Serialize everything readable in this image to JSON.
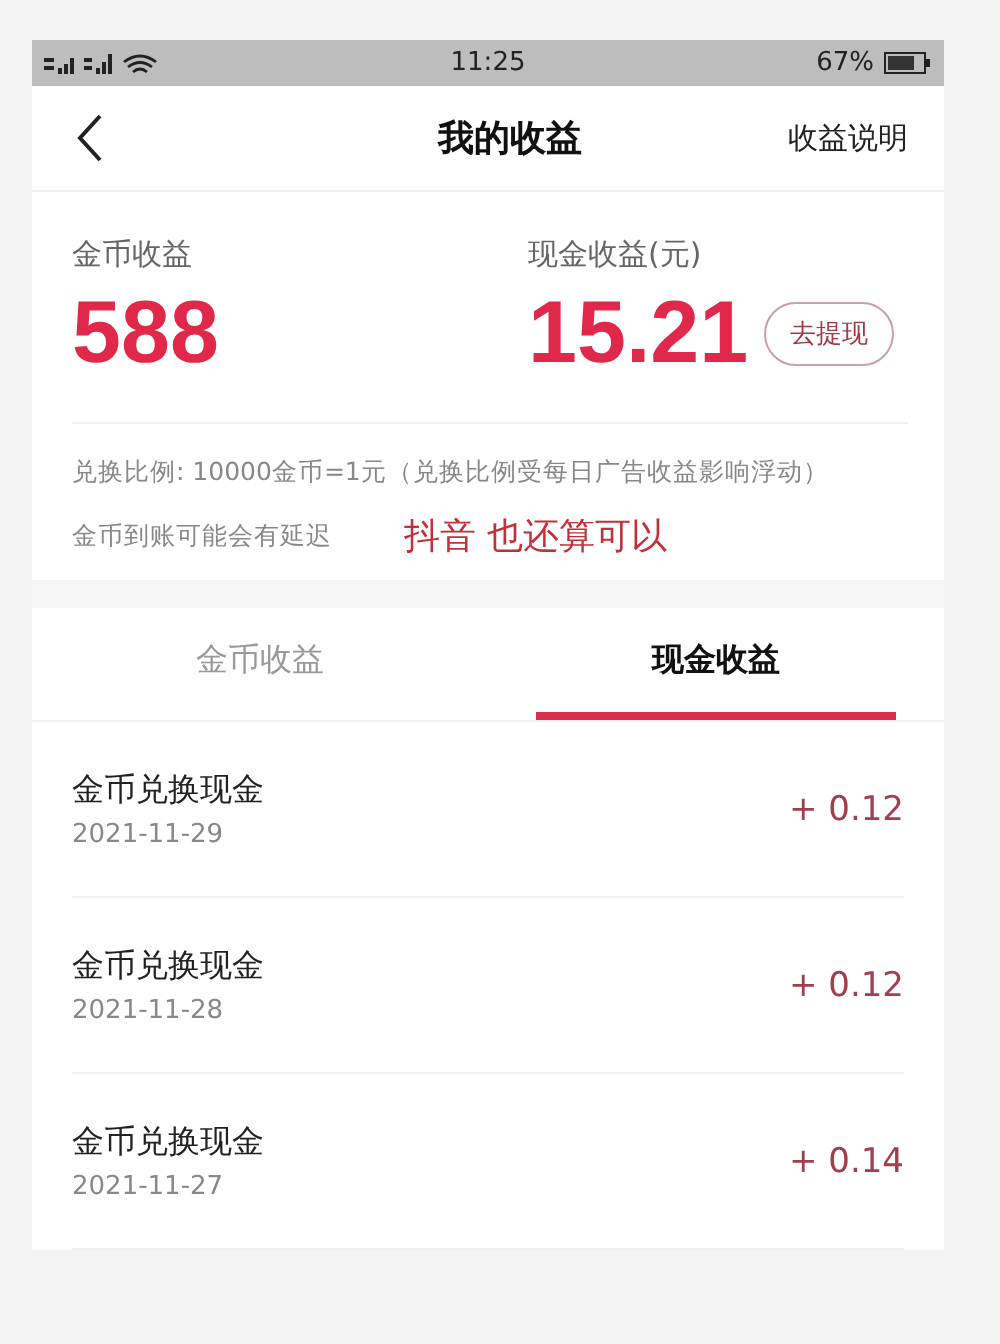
{
  "status_bar": {
    "time": "11:25",
    "battery": "67%"
  },
  "header": {
    "title": "我的收益",
    "action": "收益说明"
  },
  "summary": {
    "coin_label": "金币收益",
    "coin_value": "588",
    "cash_label": "现金收益(元)",
    "cash_value": "15.21",
    "withdraw_button": "去提现",
    "ratio_note": "兑换比例: 10000金币=1元（兑换比例受每日广告收益影响浮动）",
    "delay_note": "金币到账可能会有延迟",
    "annotation": "抖音 也还算可以"
  },
  "tabs": [
    {
      "label": "金币收益",
      "selected": false
    },
    {
      "label": "现金收益",
      "selected": true
    }
  ],
  "records": [
    {
      "title": "金币兑换现金",
      "date": "2021-11-29",
      "amount": "+ 0.12"
    },
    {
      "title": "金币兑换现金",
      "date": "2021-11-28",
      "amount": "+ 0.12"
    },
    {
      "title": "金币兑换现金",
      "date": "2021-11-27",
      "amount": "+ 0.14"
    }
  ]
}
